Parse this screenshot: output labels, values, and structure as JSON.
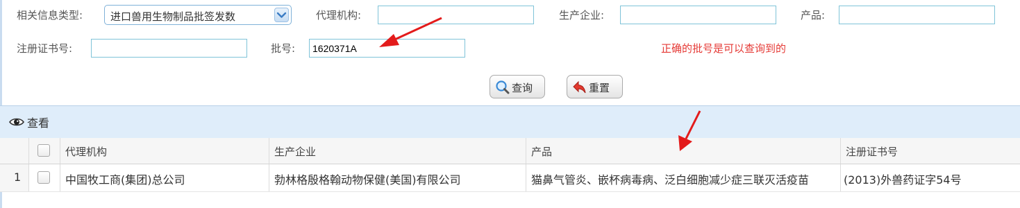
{
  "form": {
    "info_type_label": "相关信息类型:",
    "info_type_value": "进口兽用生物制品批签发数",
    "agent_label": "代理机构:",
    "agent_value": "",
    "manufacturer_label": "生产企业:",
    "manufacturer_value": "",
    "product_label": "产品:",
    "product_value": "",
    "reg_no_label": "注册证书号:",
    "reg_no_value": "",
    "batch_label": "批号:",
    "batch_value": "1620371A",
    "note": "正确的批号是可以查询到的"
  },
  "buttons": {
    "search": "查询",
    "reset": "重置"
  },
  "panel": {
    "title": "查看"
  },
  "table": {
    "columns": [
      "代理机构",
      "生产企业",
      "产品",
      "注册证书号"
    ],
    "rows": [
      {
        "index": "1",
        "agent": "中国牧工商(集团)总公司",
        "manufacturer": "勃林格殷格翰动物保健(美国)有限公司",
        "product": "猫鼻气管炎、嵌杯病毒病、泛白细胞减少症三联灭活疫苗",
        "reg_no": "(2013)外兽药证字54号"
      }
    ]
  },
  "colors": {
    "annotation_red": "#e31b1b",
    "note_red": "#e53935",
    "panel_blue": "#dfedfa",
    "input_border": "#7fc3d8"
  },
  "icons": [
    "dropdown-arrow-icon",
    "search-icon",
    "reset-icon",
    "eye-icon",
    "red-arrow-annotation"
  ]
}
